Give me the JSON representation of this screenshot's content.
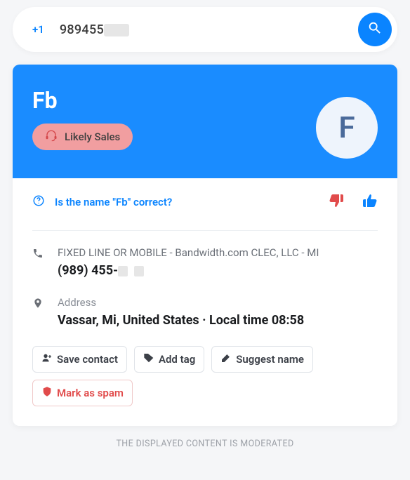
{
  "search": {
    "country_code": "+1",
    "value_visible": "989455",
    "placeholder": ""
  },
  "profile": {
    "name": "Fb",
    "avatar_initial": "F",
    "badge": {
      "label": "Likely Sales",
      "icon": "headset-icon"
    }
  },
  "name_check": {
    "prompt": "Is the name \"Fb\" correct?"
  },
  "phone": {
    "carrier": "FIXED LINE OR MOBILE - Bandwidth.com CLEC, LLC - MI",
    "number_visible": "(989) 455-"
  },
  "address": {
    "label": "Address",
    "value": "Vassar, Mi, United States · Local time 08:58"
  },
  "actions": {
    "save": "Save contact",
    "add_tag": "Add tag",
    "suggest_name": "Suggest name",
    "mark_spam": "Mark as spam"
  },
  "footer": "THE DISPLAYED CONTENT IS MODERATED"
}
